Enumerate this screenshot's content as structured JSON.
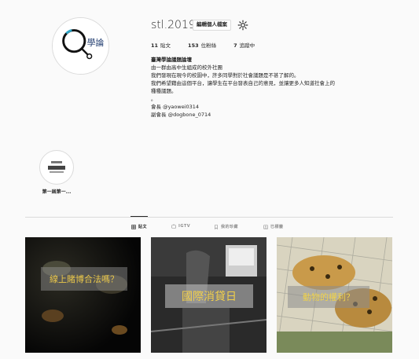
{
  "profile": {
    "username": "stl.2019",
    "edit_button": "編輯個人檔案",
    "avatar_text": "學論",
    "stats": [
      {
        "value": "11",
        "label": "貼文"
      },
      {
        "value": "153",
        "label": "位粉絲"
      },
      {
        "value": "7",
        "label": "追蹤中"
      }
    ],
    "bio": {
      "name": "臺灣學論議題論壇",
      "lines": [
        "由一群由高中生組成的校外社團",
        "我們發現在現今的校園中，許多同學對於社會議題是不甚了解的。",
        "我們希望藉由這個平台，讓學生在平台發表自己的意見，並讓更多人知道社會上的種種議題。",
        "。"
      ],
      "lines2": [
        "會長 @yaowei0314",
        "副會長 @dogbone_0714"
      ]
    }
  },
  "highlights": [
    {
      "label": "第一屆第一..."
    }
  ],
  "tabs": [
    {
      "label": "貼文",
      "icon": "grid-icon",
      "active": true
    },
    {
      "label": "IGTV",
      "icon": "igtv-icon",
      "active": false
    },
    {
      "label": "我的珍藏",
      "icon": "bookmark-icon",
      "active": false
    },
    {
      "label": "已標籤",
      "icon": "tag-icon",
      "active": false
    }
  ],
  "posts": [
    {
      "caption": "線上賭博合法嗎？"
    },
    {
      "caption": "國際消貸日"
    },
    {
      "caption": "動物的權利？"
    }
  ]
}
